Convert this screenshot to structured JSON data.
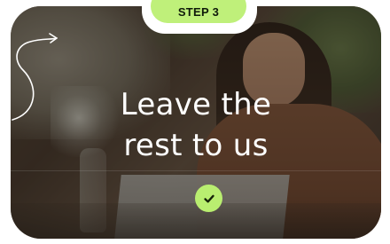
{
  "step": {
    "label": "STEP 3"
  },
  "card": {
    "headline_line1": "Leave the",
    "headline_line2": "rest to us",
    "status_icon": "check-icon"
  },
  "colors": {
    "accent_green": "#bff07a",
    "check_circle": "#b9ee70",
    "headline_text": "#ffffff"
  }
}
